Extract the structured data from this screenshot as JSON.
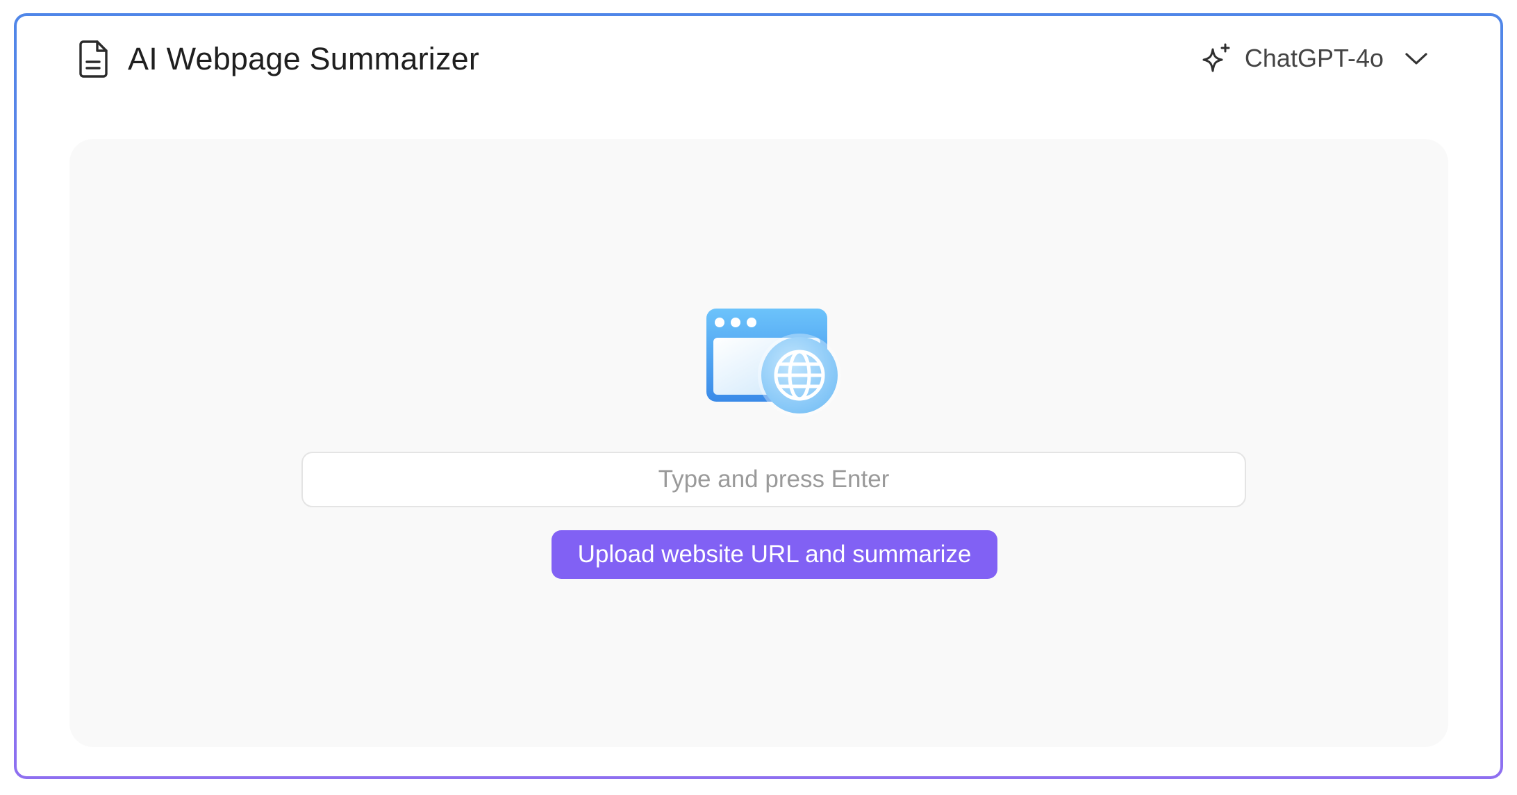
{
  "header": {
    "title": "AI Webpage Summarizer",
    "title_icon": "document-icon",
    "model_selector": {
      "icon": "sparkle-icon",
      "selected": "ChatGPT-4o",
      "dropdown_icon": "chevron-down-icon"
    }
  },
  "main": {
    "illustration": "browser-globe-icon",
    "url_input": {
      "value": "",
      "placeholder": "Type and press Enter"
    },
    "submit_label": "Upload website URL and summarize"
  },
  "colors": {
    "accent": "#8161f4",
    "frame_top": "#4f86e8",
    "frame_bottom": "#8e6ff0",
    "panel_bg": "#f9f9f9",
    "illustration_blue": "#3f94ea"
  }
}
